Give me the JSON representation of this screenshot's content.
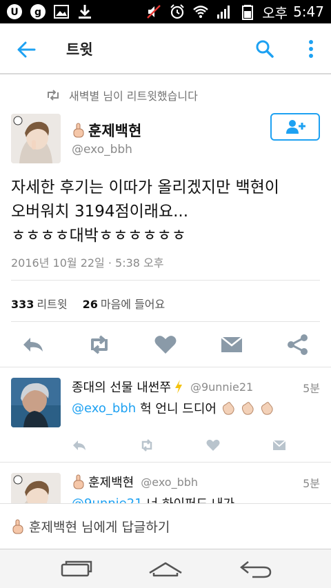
{
  "status_bar": {
    "carrier_label": "오후",
    "time": "5:47"
  },
  "app_bar": {
    "title": "트윗"
  },
  "retweet_notice": "새벽별 님이 리트윗했습니다",
  "main_tweet": {
    "display_name": "훈제백현",
    "handle": "@exo_bbh",
    "text_line1": "자세한 후기는 이따가 올리겠지만 백현이",
    "text_line2": "오버워치 3194점이래요...",
    "text_line3": "ㅎㅎㅎㅎ대박ㅎㅎㅎㅎㅎㅎ",
    "date": "2016년 10월 22일 · 5:38 오후",
    "retweet_count": "333",
    "retweet_label": "리트윗",
    "like_count": "26",
    "like_label": "마음에 들어요"
  },
  "replies": [
    {
      "display_name": "종대의 선물 내썬쭈",
      "handle": "@9unnie21",
      "time": "5분",
      "mention": "@exo_bbh",
      "text": "헉 언니 드디어"
    },
    {
      "display_name": "훈제백현",
      "handle": "@exo_bbh",
      "time": "5분",
      "mention": "@9unnie21",
      "text": "너 하이퍼드 내가"
    }
  ],
  "composer": {
    "placeholder": "훈제백현 님에게 답글하기"
  },
  "colors": {
    "accent": "#1da1f2",
    "icon_gray": "#8a9aa8"
  }
}
